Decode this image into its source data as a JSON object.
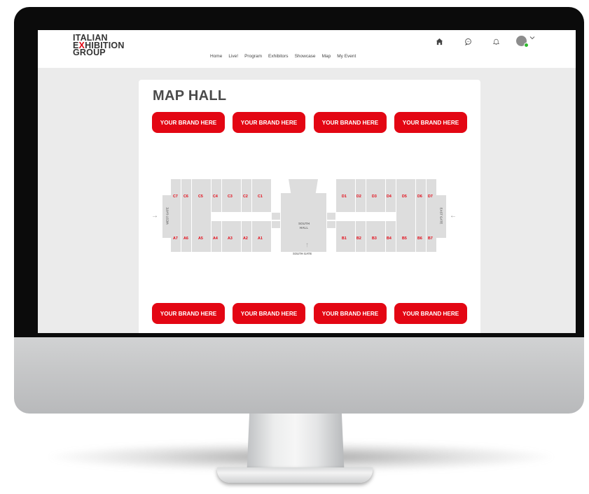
{
  "logo": {
    "line1": "ITALIAN",
    "line2_accent": "X",
    "line2_pre": "E",
    "line2_post": "HIBITION",
    "line3": "GROUP"
  },
  "nav": {
    "items": [
      "Home",
      "Live!",
      "Program",
      "Exhibitors",
      "Showcase",
      "Map",
      "My Event"
    ]
  },
  "page": {
    "title": "MAP HALL"
  },
  "brand_buttons": {
    "top": [
      "YOUR BRAND HERE",
      "YOUR BRAND HERE",
      "YOUR BRAND HERE",
      "YOUR BRAND HERE"
    ],
    "bottom": [
      "YOUR BRAND HERE",
      "YOUR BRAND HERE",
      "YOUR BRAND HERE",
      "YOUR BRAND HERE"
    ]
  },
  "map": {
    "west_c": [
      "C7",
      "C6",
      "C5",
      "C4",
      "C3",
      "C2",
      "C1"
    ],
    "west_a": [
      "A7",
      "A6",
      "A5",
      "A4",
      "A3",
      "A2",
      "A1"
    ],
    "east_d": [
      "D1",
      "D2",
      "D3",
      "D4",
      "D5",
      "D6",
      "D7"
    ],
    "east_b": [
      "B1",
      "B2",
      "B3",
      "B4",
      "B5",
      "B6",
      "B7"
    ],
    "west_gate": "WEST GATE",
    "east_gate": "EAST GATE",
    "south_hall": "SOUTH HALL",
    "south_gate": "SOUTH GATE"
  },
  "icons": {
    "home": "home-icon",
    "chat": "chat-icon",
    "bell": "bell-icon",
    "chevron": "chevron-down-icon"
  },
  "colors": {
    "brand": "#e30613",
    "online": "#2eb82e"
  }
}
